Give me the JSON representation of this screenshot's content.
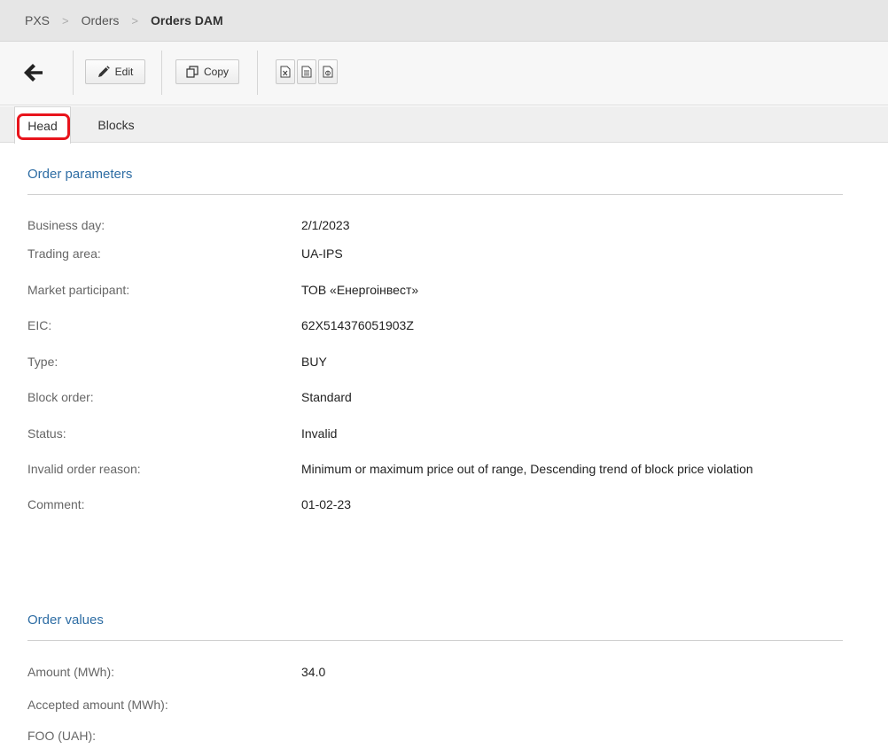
{
  "breadcrumb": {
    "items": [
      "PXS",
      "Orders",
      "Orders DAM"
    ],
    "separator": ">"
  },
  "toolbar": {
    "back_icon": "arrow-left-icon",
    "edit_label": "Edit",
    "edit_icon": "pencil-icon",
    "copy_label": "Copy",
    "copy_icon": "copy-icon",
    "export_icons": [
      "excel-file-icon",
      "text-file-icon",
      "pdf-file-icon"
    ]
  },
  "tabs": [
    {
      "label": "Head",
      "active": true
    },
    {
      "label": "Blocks",
      "active": false
    }
  ],
  "highlight_color": "#e8141c",
  "accent_color": "#2e6da4",
  "order_parameters": {
    "title": "Order parameters",
    "rows": [
      {
        "label": "Business day:",
        "value": "2/1/2023"
      },
      {
        "label": "Trading area:",
        "value": "UA-IPS"
      },
      {
        "label": "Market participant:",
        "value": "ТОВ «Енергоінвест»"
      },
      {
        "label": "EIC:",
        "value": "62X514376051903Z"
      },
      {
        "label": "Type:",
        "value": "BUY"
      },
      {
        "label": "Block order:",
        "value": "Standard"
      },
      {
        "label": "Status:",
        "value": "Invalid"
      },
      {
        "label": "Invalid order reason:",
        "value": "Minimum or maximum price out of range, Descending trend of block price violation"
      },
      {
        "label": "Comment:",
        "value": "01-02-23"
      }
    ]
  },
  "order_values": {
    "title": "Order values",
    "rows": [
      {
        "label": "Amount (MWh):",
        "value": "34.0"
      },
      {
        "label": "Accepted amount (MWh):",
        "value": ""
      },
      {
        "label": "FOO (UAH):",
        "value": ""
      }
    ]
  }
}
